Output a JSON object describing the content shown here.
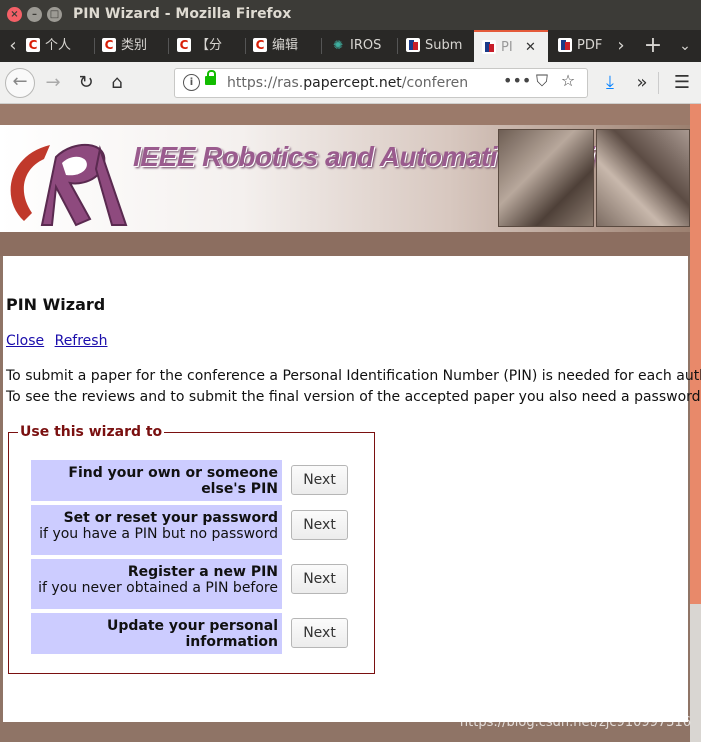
{
  "window": {
    "title": "PIN Wizard - Mozilla Firefox"
  },
  "tabs": [
    {
      "label": "个人",
      "icon": "c-icon"
    },
    {
      "label": "类别",
      "icon": "c-icon"
    },
    {
      "label": "【分",
      "icon": "c-icon"
    },
    {
      "label": "编辑",
      "icon": "c-icon"
    },
    {
      "label": "IROS",
      "icon": "iros-icon"
    },
    {
      "label": "Subm",
      "icon": "papercept-icon"
    },
    {
      "label": "PI",
      "icon": "papercept-icon",
      "active": true
    },
    {
      "label": "PDF",
      "icon": "papercept-icon"
    }
  ],
  "tab_close_glyph": "✕",
  "nav": {
    "url_host": "https://ras.",
    "url_domain": "papercept.net",
    "url_path": "/conferenc",
    "icons": [
      "back-icon",
      "forward-icon",
      "reload-icon",
      "home-icon",
      "info-icon",
      "lock-icon",
      "more-icon",
      "pocket-icon",
      "bookmark-star-icon",
      "download-icon",
      "overflow-icon",
      "menu-icon"
    ]
  },
  "banner": {
    "title": "IEEE Robotics and Automation Society"
  },
  "page": {
    "heading": "PIN Wizard",
    "links": [
      "Close",
      "Refresh"
    ],
    "intro_line1": "To submit a paper for the conference a Personal Identification Number (PIN) is needed for each author.",
    "intro_line2": "To see the reviews and to submit the final version of the accepted paper you also need a password",
    "wizard_legend": "Use this wizard to",
    "options": [
      {
        "title": "Find your own or someone else's PIN",
        "subtitle": "",
        "button": "Next"
      },
      {
        "title": "Set or reset your password",
        "subtitle": "if you have a PIN but no password",
        "button": "Next"
      },
      {
        "title": "Register a new PIN",
        "subtitle": "if you never obtained a PIN before",
        "button": "Next"
      },
      {
        "title": "Update your personal information",
        "subtitle": "",
        "button": "Next"
      }
    ]
  },
  "watermark": "https://blog.csdn.net/zjc910997316",
  "colors": {
    "accent_tab": "#e45a3a",
    "option_bg": "#ccccff",
    "fieldset_border": "#7a1010",
    "link": "#1a0dab",
    "banner_title": "#9a5b8e"
  }
}
